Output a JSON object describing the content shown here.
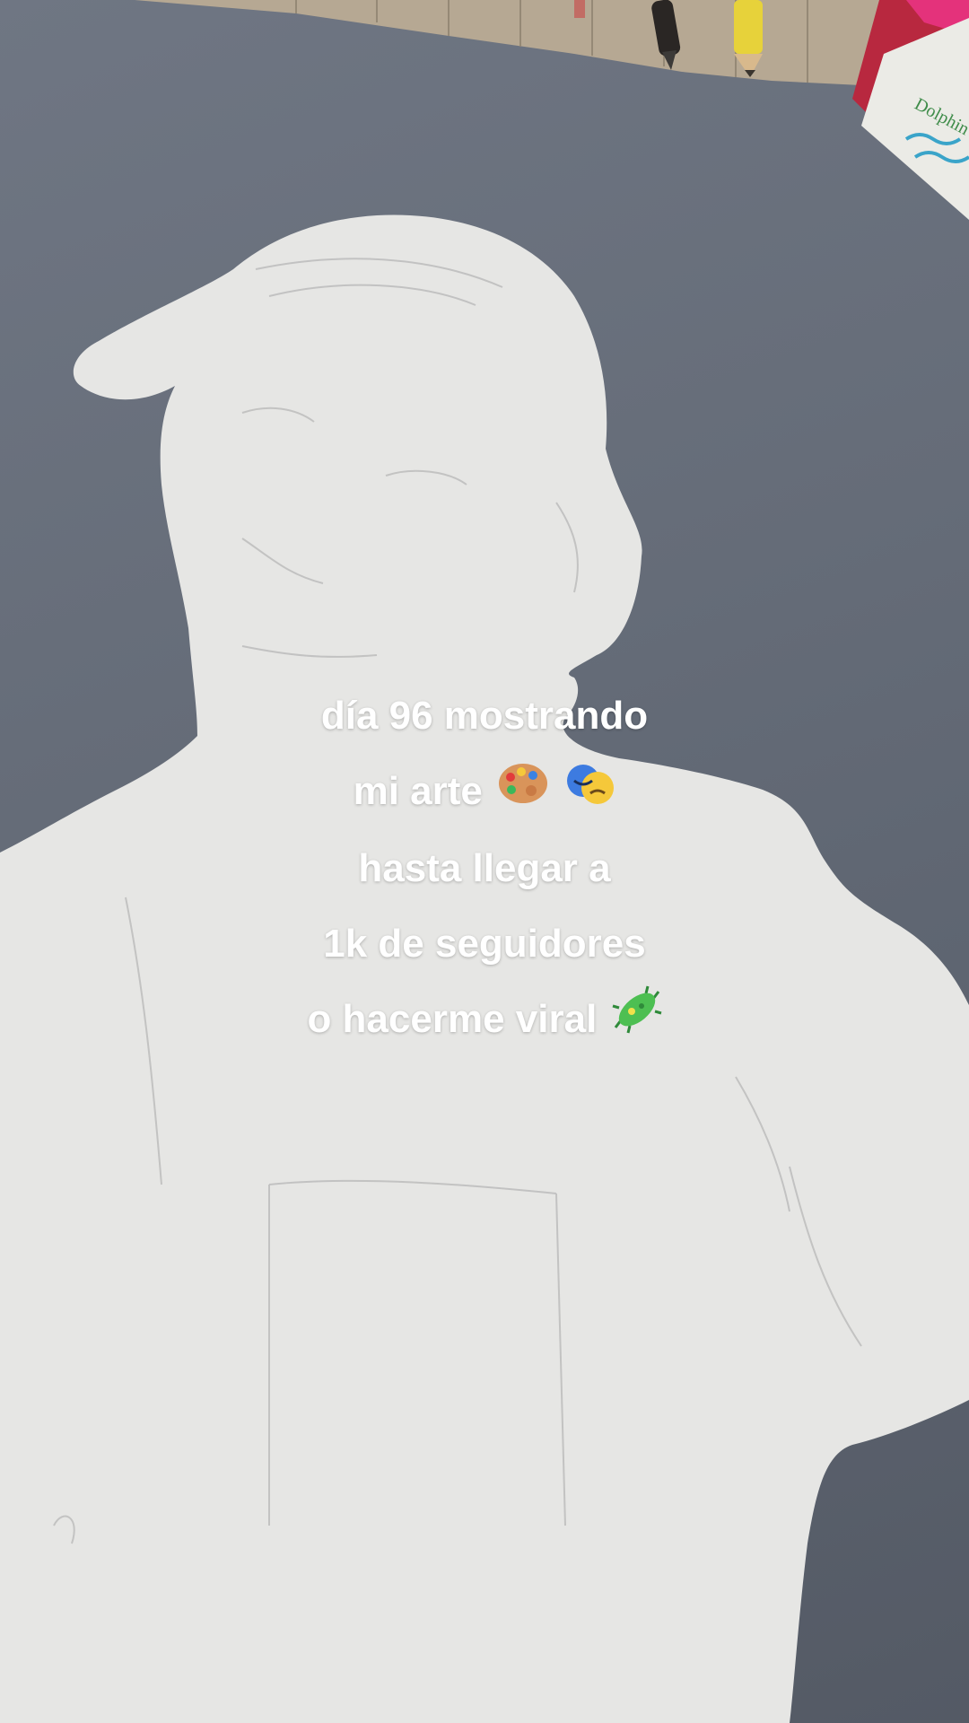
{
  "caption": {
    "line1": "día 96 mostrando",
    "line2": "mi arte",
    "line3": "hasta llegar a",
    "line4": "1k de seguidores",
    "line5": "o hacerme viral"
  },
  "line2_icons": [
    "artist-palette-icon",
    "performing-arts-icon"
  ],
  "line5_icons": [
    "microbe-icon"
  ],
  "props": {
    "box_brand": "Dolphin"
  },
  "colors": {
    "gray_paper": "#656c78",
    "white_cutout": "#e6e6e4",
    "cutting_mat": "#b7a996",
    "text": "#ffffff"
  }
}
